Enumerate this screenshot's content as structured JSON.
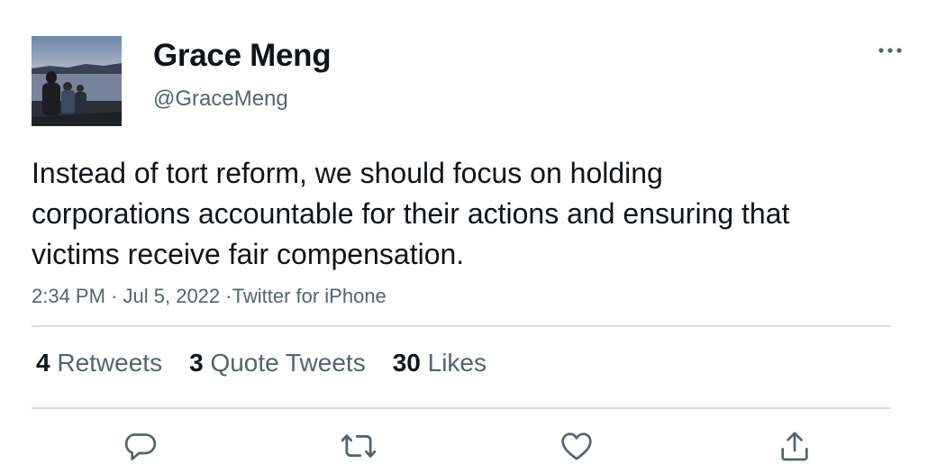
{
  "user": {
    "display_name": "Grace Meng",
    "handle": "@GraceMeng"
  },
  "tweet": {
    "text": "Instead of tort reform, we should focus on holding corporations accountable for their actions and ensuring that victims receive fair compensation.",
    "time": "2:34 PM",
    "date": "Jul 5, 2022",
    "source": "Twitter for iPhone",
    "separator": "·"
  },
  "stats": {
    "retweets_count": "4",
    "retweets_label": "Retweets",
    "quotes_count": "3",
    "quotes_label": "Quote Tweets",
    "likes_count": "30",
    "likes_label": "Likes"
  },
  "actions": {
    "reply_icon": "reply-icon",
    "retweet_icon": "retweet-icon",
    "like_icon": "heart-icon",
    "share_icon": "share-icon"
  },
  "colors": {
    "text_primary": "#0f1419",
    "text_secondary": "#536471",
    "divider": "#d9dde1"
  }
}
